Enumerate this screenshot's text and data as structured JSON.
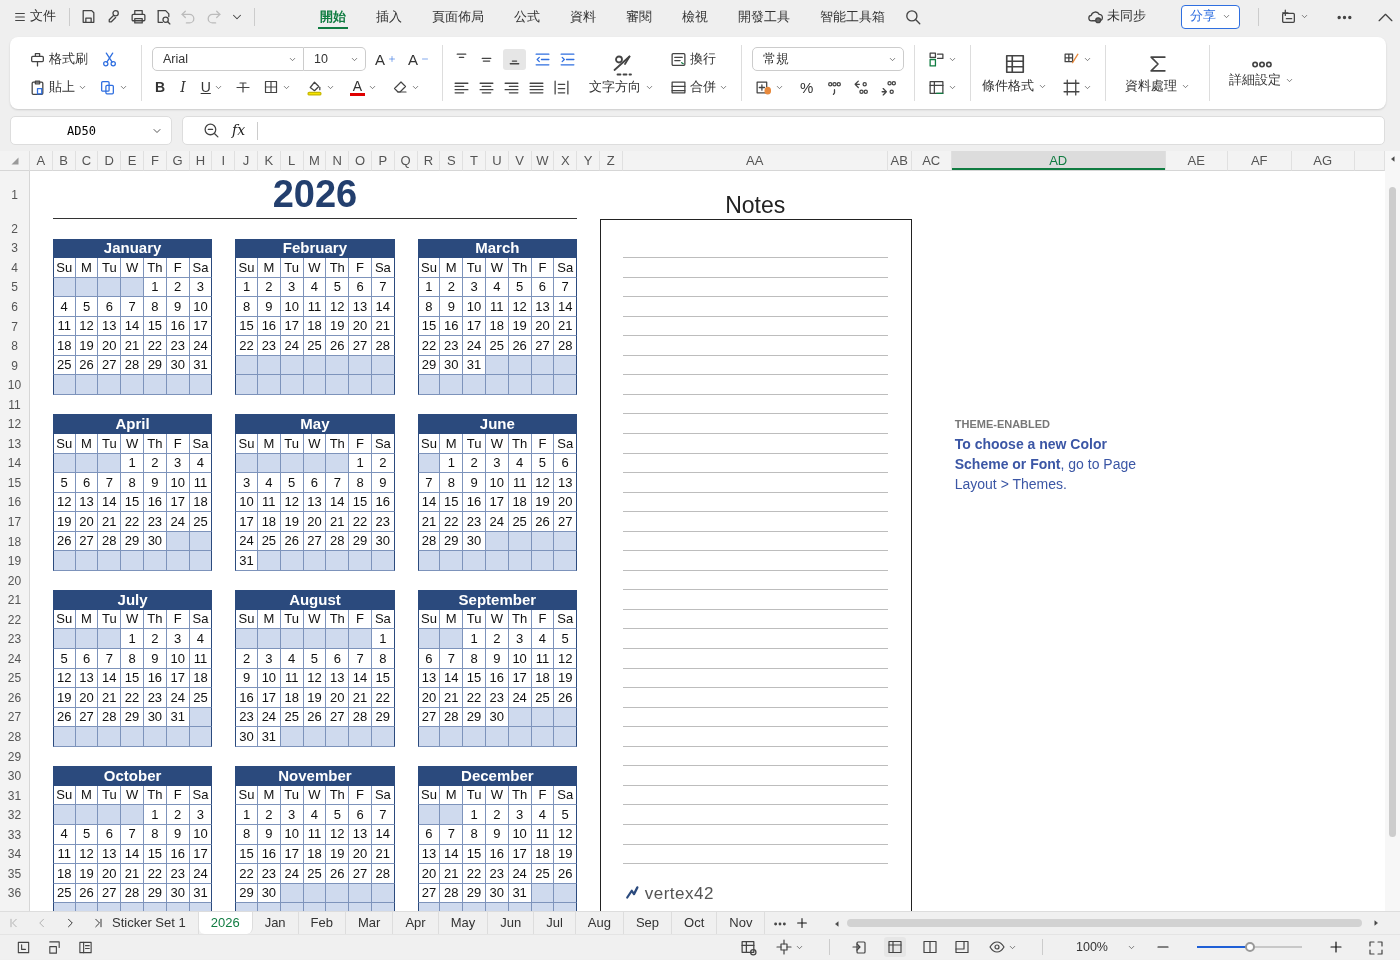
{
  "title_bar": {
    "menu_label": "文件",
    "tabs": [
      {
        "label": "開始",
        "selected": true
      },
      {
        "label": "插入",
        "selected": false
      },
      {
        "label": "頁面佈局",
        "selected": false
      },
      {
        "label": "公式",
        "selected": false
      },
      {
        "label": "資料",
        "selected": false
      },
      {
        "label": "審閱",
        "selected": false
      },
      {
        "label": "檢視",
        "selected": false
      },
      {
        "label": "開發工具",
        "selected": false
      },
      {
        "label": "智能工具箱",
        "selected": false
      }
    ],
    "sync_status": "未同步",
    "share_button": "分享"
  },
  "ribbon": {
    "format_painter": "格式刷",
    "paste": "貼上",
    "font": "Arial",
    "font_size": "10",
    "grow_font": "A",
    "shrink_font": "A",
    "bold": "B",
    "italic": "I",
    "underline": "U",
    "font_color": "A",
    "text_direction": "文字方向",
    "wrap": "換行",
    "merge": "合併",
    "number_format": "常規",
    "percent": "%",
    "conditional_format": "條件格式",
    "data_tools": "資料處理",
    "more_settings": "詳細設定"
  },
  "formula_bar": {
    "name_box": "AD50",
    "function_label": "fx"
  },
  "columns": [
    {
      "label": "A",
      "selected": false
    },
    {
      "label": "B",
      "selected": false
    },
    {
      "label": "C",
      "selected": false
    },
    {
      "label": "D",
      "selected": false
    },
    {
      "label": "E",
      "selected": false
    },
    {
      "label": "F",
      "selected": false
    },
    {
      "label": "G",
      "selected": false
    },
    {
      "label": "H",
      "selected": false
    },
    {
      "label": "I",
      "selected": false
    },
    {
      "label": "J",
      "selected": false
    },
    {
      "label": "K",
      "selected": false
    },
    {
      "label": "L",
      "selected": false
    },
    {
      "label": "M",
      "selected": false
    },
    {
      "label": "N",
      "selected": false
    },
    {
      "label": "O",
      "selected": false
    },
    {
      "label": "P",
      "selected": false
    },
    {
      "label": "Q",
      "selected": false
    },
    {
      "label": "R",
      "selected": false
    },
    {
      "label": "S",
      "selected": false
    },
    {
      "label": "T",
      "selected": false
    },
    {
      "label": "U",
      "selected": false
    },
    {
      "label": "V",
      "selected": false
    },
    {
      "label": "W",
      "selected": false
    },
    {
      "label": "X",
      "selected": false
    },
    {
      "label": "Y",
      "selected": false
    },
    {
      "label": "Z",
      "selected": false
    },
    {
      "label": "AA",
      "selected": false
    },
    {
      "label": "AB",
      "selected": false
    },
    {
      "label": "AC",
      "selected": false
    },
    {
      "label": "AD",
      "selected": true
    },
    {
      "label": "AE",
      "selected": false
    },
    {
      "label": "AF",
      "selected": false
    },
    {
      "label": "AG",
      "selected": false
    }
  ],
  "rows": [
    "1",
    "2",
    "3",
    "4",
    "5",
    "6",
    "7",
    "8",
    "9",
    "10",
    "11",
    "12",
    "13",
    "14",
    "15",
    "16",
    "17",
    "18",
    "19",
    "20",
    "21",
    "22",
    "23",
    "24",
    "25",
    "26",
    "27",
    "28",
    "29",
    "30",
    "31",
    "32",
    "33",
    "34",
    "35",
    "36"
  ],
  "sheet": {
    "year": "2026",
    "months": [
      {
        "name": "January",
        "weekdays": [
          "Su",
          "M",
          "Tu",
          "W",
          "Th",
          "F",
          "Sa"
        ],
        "weeks": [
          {
            "kind": "first",
            "days": [
              "1",
              "2",
              "3"
            ]
          },
          {
            "kind": "week",
            "days": [
              "4",
              "5",
              "6",
              "7",
              "8",
              "9",
              "10"
            ]
          },
          {
            "kind": "week",
            "days": [
              "11",
              "12",
              "13",
              "14",
              "15",
              "16",
              "17"
            ]
          },
          {
            "kind": "week",
            "days": [
              "18",
              "19",
              "20",
              "21",
              "22",
              "23",
              "24"
            ]
          },
          {
            "kind": "week",
            "days": [
              "25",
              "26",
              "27",
              "28",
              "29",
              "30",
              "31"
            ]
          },
          {
            "kind": "blank"
          }
        ]
      },
      {
        "name": "February",
        "weekdays": [
          "Su",
          "M",
          "Tu",
          "W",
          "Th",
          "F",
          "Sa"
        ],
        "weeks": [
          {
            "kind": "first",
            "days": [
              "1",
              "2",
              "3",
              "4",
              "5",
              "6",
              "7"
            ]
          },
          {
            "kind": "week",
            "days": [
              "8",
              "9",
              "10",
              "11",
              "12",
              "13",
              "14"
            ]
          },
          {
            "kind": "week",
            "days": [
              "15",
              "16",
              "17",
              "18",
              "19",
              "20",
              "21"
            ]
          },
          {
            "kind": "week",
            "days": [
              "22",
              "23",
              "24",
              "25",
              "26",
              "27",
              "28"
            ]
          },
          {
            "kind": "blank"
          },
          {
            "kind": "blank"
          }
        ]
      },
      {
        "name": "March",
        "weekdays": [
          "Su",
          "M",
          "Tu",
          "W",
          "Th",
          "F",
          "Sa"
        ],
        "weeks": [
          {
            "kind": "first",
            "days": [
              "1",
              "2",
              "3",
              "4",
              "5",
              "6",
              "7"
            ]
          },
          {
            "kind": "week",
            "days": [
              "8",
              "9",
              "10",
              "11",
              "12",
              "13",
              "14"
            ]
          },
          {
            "kind": "week",
            "days": [
              "15",
              "16",
              "17",
              "18",
              "19",
              "20",
              "21"
            ]
          },
          {
            "kind": "week",
            "days": [
              "22",
              "23",
              "24",
              "25",
              "26",
              "27",
              "28"
            ]
          },
          {
            "kind": "week",
            "days": [
              "29",
              "30",
              "31"
            ]
          },
          {
            "kind": "blank"
          }
        ]
      },
      {
        "name": "April",
        "weekdays": [
          "Su",
          "M",
          "Tu",
          "W",
          "Th",
          "F",
          "Sa"
        ],
        "weeks": [
          {
            "kind": "first",
            "days": [
              "1",
              "2",
              "3",
              "4"
            ]
          },
          {
            "kind": "week",
            "days": [
              "5",
              "6",
              "7",
              "8",
              "9",
              "10",
              "11"
            ]
          },
          {
            "kind": "week",
            "days": [
              "12",
              "13",
              "14",
              "15",
              "16",
              "17",
              "18"
            ]
          },
          {
            "kind": "week",
            "days": [
              "19",
              "20",
              "21",
              "22",
              "23",
              "24",
              "25"
            ]
          },
          {
            "kind": "week",
            "days": [
              "26",
              "27",
              "28",
              "29",
              "30"
            ]
          },
          {
            "kind": "blank"
          }
        ]
      },
      {
        "name": "May",
        "weekdays": [
          "Su",
          "M",
          "Tu",
          "W",
          "Th",
          "F",
          "Sa"
        ],
        "weeks": [
          {
            "kind": "first",
            "days": [
              "1",
              "2"
            ]
          },
          {
            "kind": "week",
            "days": [
              "3",
              "4",
              "5",
              "6",
              "7",
              "8",
              "9"
            ]
          },
          {
            "kind": "week",
            "days": [
              "10",
              "11",
              "12",
              "13",
              "14",
              "15",
              "16"
            ]
          },
          {
            "kind": "week",
            "days": [
              "17",
              "18",
              "19",
              "20",
              "21",
              "22",
              "23"
            ]
          },
          {
            "kind": "week",
            "days": [
              "24",
              "25",
              "26",
              "27",
              "28",
              "29",
              "30"
            ]
          },
          {
            "kind": "week",
            "days": [
              "31"
            ]
          }
        ]
      },
      {
        "name": "June",
        "weekdays": [
          "Su",
          "M",
          "Tu",
          "W",
          "Th",
          "F",
          "Sa"
        ],
        "weeks": [
          {
            "kind": "first",
            "days": [
              "1",
              "2",
              "3",
              "4",
              "5",
              "6"
            ]
          },
          {
            "kind": "week",
            "days": [
              "7",
              "8",
              "9",
              "10",
              "11",
              "12",
              "13"
            ]
          },
          {
            "kind": "week",
            "days": [
              "14",
              "15",
              "16",
              "17",
              "18",
              "19",
              "20"
            ]
          },
          {
            "kind": "week",
            "days": [
              "21",
              "22",
              "23",
              "24",
              "25",
              "26",
              "27"
            ]
          },
          {
            "kind": "week",
            "days": [
              "28",
              "29",
              "30"
            ]
          },
          {
            "kind": "blank"
          }
        ]
      },
      {
        "name": "July",
        "weekdays": [
          "Su",
          "M",
          "Tu",
          "W",
          "Th",
          "F",
          "Sa"
        ],
        "weeks": [
          {
            "kind": "first",
            "days": [
              "1",
              "2",
              "3",
              "4"
            ]
          },
          {
            "kind": "week",
            "days": [
              "5",
              "6",
              "7",
              "8",
              "9",
              "10",
              "11"
            ]
          },
          {
            "kind": "week",
            "days": [
              "12",
              "13",
              "14",
              "15",
              "16",
              "17",
              "18"
            ]
          },
          {
            "kind": "week",
            "days": [
              "19",
              "20",
              "21",
              "22",
              "23",
              "24",
              "25"
            ]
          },
          {
            "kind": "week",
            "days": [
              "26",
              "27",
              "28",
              "29",
              "30",
              "31"
            ]
          },
          {
            "kind": "blank"
          }
        ]
      },
      {
        "name": "August",
        "weekdays": [
          "Su",
          "M",
          "Tu",
          "W",
          "Th",
          "F",
          "Sa"
        ],
        "weeks": [
          {
            "kind": "first",
            "days": [
              "1"
            ]
          },
          {
            "kind": "week",
            "days": [
              "2",
              "3",
              "4",
              "5",
              "6",
              "7",
              "8"
            ]
          },
          {
            "kind": "week",
            "days": [
              "9",
              "10",
              "11",
              "12",
              "13",
              "14",
              "15"
            ]
          },
          {
            "kind": "week",
            "days": [
              "16",
              "17",
              "18",
              "19",
              "20",
              "21",
              "22"
            ]
          },
          {
            "kind": "week",
            "days": [
              "23",
              "24",
              "25",
              "26",
              "27",
              "28",
              "29"
            ]
          },
          {
            "kind": "week",
            "days": [
              "30",
              "31"
            ]
          }
        ]
      },
      {
        "name": "September",
        "weekdays": [
          "Su",
          "M",
          "Tu",
          "W",
          "Th",
          "F",
          "Sa"
        ],
        "weeks": [
          {
            "kind": "first",
            "days": [
              "1",
              "2",
              "3",
              "4",
              "5"
            ]
          },
          {
            "kind": "week",
            "days": [
              "6",
              "7",
              "8",
              "9",
              "10",
              "11",
              "12"
            ]
          },
          {
            "kind": "week",
            "days": [
              "13",
              "14",
              "15",
              "16",
              "17",
              "18",
              "19"
            ]
          },
          {
            "kind": "week",
            "days": [
              "20",
              "21",
              "22",
              "23",
              "24",
              "25",
              "26"
            ]
          },
          {
            "kind": "week",
            "days": [
              "27",
              "28",
              "29",
              "30"
            ]
          },
          {
            "kind": "blank"
          }
        ]
      },
      {
        "name": "October",
        "weekdays": [
          "Su",
          "M",
          "Tu",
          "W",
          "Th",
          "F",
          "Sa"
        ],
        "weeks": [
          {
            "kind": "first",
            "days": [
              "1",
              "2",
              "3"
            ]
          },
          {
            "kind": "week",
            "days": [
              "4",
              "5",
              "6",
              "7",
              "8",
              "9",
              "10"
            ]
          },
          {
            "kind": "week",
            "days": [
              "11",
              "12",
              "13",
              "14",
              "15",
              "16",
              "17"
            ]
          },
          {
            "kind": "week",
            "days": [
              "18",
              "19",
              "20",
              "21",
              "22",
              "23",
              "24"
            ]
          },
          {
            "kind": "week",
            "days": [
              "25",
              "26",
              "27",
              "28",
              "29",
              "30",
              "31"
            ]
          },
          {
            "kind": "blank"
          }
        ]
      },
      {
        "name": "November",
        "weekdays": [
          "Su",
          "M",
          "Tu",
          "W",
          "Th",
          "F",
          "Sa"
        ],
        "weeks": [
          {
            "kind": "first",
            "days": [
              "1",
              "2",
              "3",
              "4",
              "5",
              "6",
              "7"
            ]
          },
          {
            "kind": "week",
            "days": [
              "8",
              "9",
              "10",
              "11",
              "12",
              "13",
              "14"
            ]
          },
          {
            "kind": "week",
            "days": [
              "15",
              "16",
              "17",
              "18",
              "19",
              "20",
              "21"
            ]
          },
          {
            "kind": "week",
            "days": [
              "22",
              "23",
              "24",
              "25",
              "26",
              "27",
              "28"
            ]
          },
          {
            "kind": "week",
            "days": [
              "29",
              "30"
            ]
          },
          {
            "kind": "blank"
          }
        ]
      },
      {
        "name": "December",
        "weekdays": [
          "Su",
          "M",
          "Tu",
          "W",
          "Th",
          "F",
          "Sa"
        ],
        "weeks": [
          {
            "kind": "first",
            "days": [
              "1",
              "2",
              "3",
              "4",
              "5"
            ]
          },
          {
            "kind": "week",
            "days": [
              "6",
              "7",
              "8",
              "9",
              "10",
              "11",
              "12"
            ]
          },
          {
            "kind": "week",
            "days": [
              "13",
              "14",
              "15",
              "16",
              "17",
              "18",
              "19"
            ]
          },
          {
            "kind": "week",
            "days": [
              "20",
              "21",
              "22",
              "23",
              "24",
              "25",
              "26"
            ]
          },
          {
            "kind": "week",
            "days": [
              "27",
              "28",
              "29",
              "30",
              "31"
            ]
          },
          {
            "kind": "blank"
          }
        ]
      }
    ],
    "notes_title": "Notes",
    "logo_text": "vertex42",
    "theme_label": "THEME-ENABLED",
    "theme_text": "**To choose a new Color Scheme or Font**,  go to Page Layout > Themes."
  },
  "sheet_tabs": [
    {
      "label": "Sticker Set 1",
      "selected": false
    },
    {
      "label": "2026",
      "selected": true
    },
    {
      "label": "Jan",
      "selected": false
    },
    {
      "label": "Feb",
      "selected": false
    },
    {
      "label": "Mar",
      "selected": false
    },
    {
      "label": "Apr",
      "selected": false
    },
    {
      "label": "May",
      "selected": false
    },
    {
      "label": "Jun",
      "selected": false
    },
    {
      "label": "Jul",
      "selected": false
    },
    {
      "label": "Aug",
      "selected": false
    },
    {
      "label": "Sep",
      "selected": false
    },
    {
      "label": "Oct",
      "selected": false
    },
    {
      "label": "Nov",
      "selected": false
    }
  ],
  "status_bar": {
    "zoom_label": "100%",
    "zoom": {
      "level": 0.5
    }
  }
}
